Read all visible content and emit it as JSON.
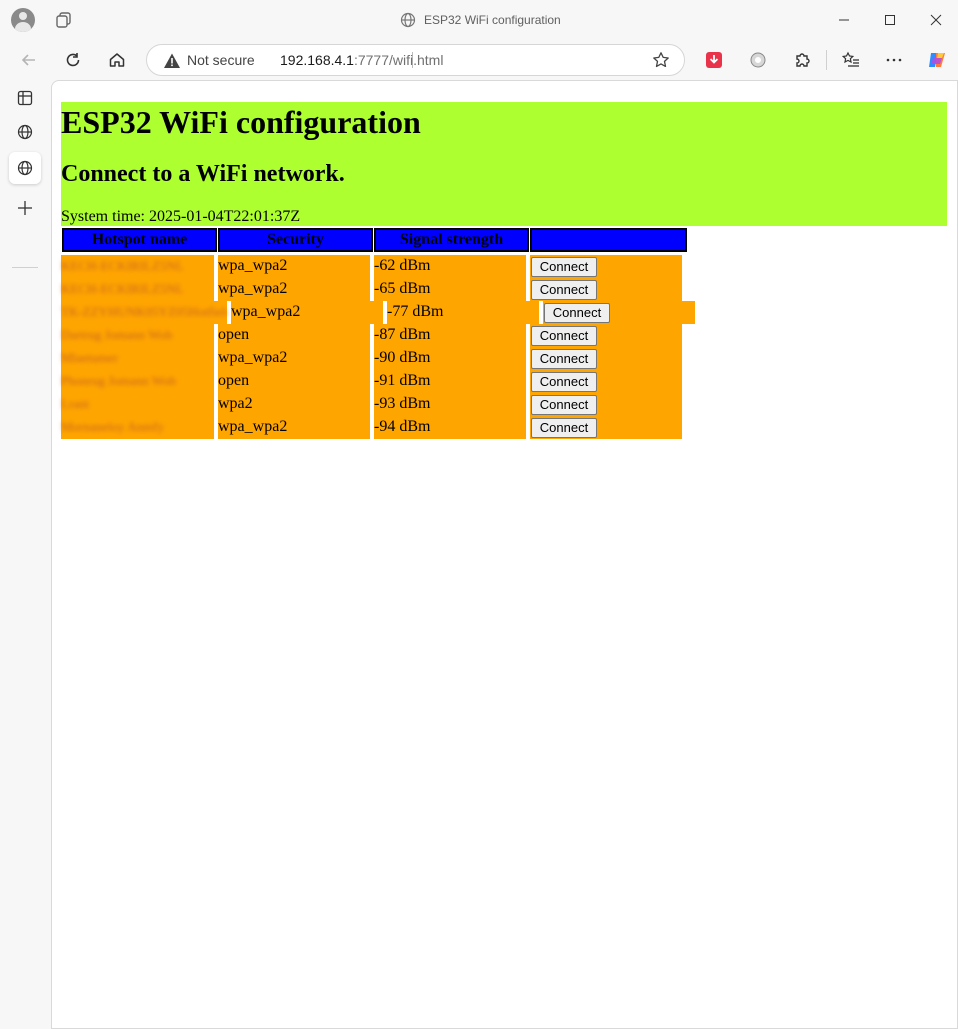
{
  "window": {
    "title": "ESP32 WiFi configuration"
  },
  "address": {
    "security": "Not secure",
    "host": "192.168.4.1",
    "rest": ":7777/wifi.html"
  },
  "page": {
    "title": "ESP32 WiFi configuration",
    "subtitle": "Connect to a WiFi network.",
    "system_time": "System time: 2025-01-04T22:01:37Z"
  },
  "table": {
    "headers": [
      "Hotspot name",
      "Security",
      "Signal strength",
      ""
    ],
    "connect_label": "Connect",
    "rows": [
      {
        "name": "KECH-ECKIRILZ5NL",
        "security": "wpa_wpa2",
        "signal": "-62 dBm"
      },
      {
        "name": "KECH-ECKIRILZ5NL",
        "security": "wpa_wpa2",
        "signal": "-65 dBm"
      },
      {
        "name": "TK-ZZYHUNK05YZ05Hotfield",
        "security": "wpa_wpa2",
        "signal": "-77 dBm"
      },
      {
        "name": "Dartrug Jomann Wob",
        "security": "open",
        "signal": "-87 dBm"
      },
      {
        "name": "Mlaetumer",
        "security": "wpa_wpa2",
        "signal": "-90 dBm"
      },
      {
        "name": "Phonrug Jomann Wob",
        "security": "open",
        "signal": "-91 dBm"
      },
      {
        "name": "Lrant",
        "security": "wpa2",
        "signal": "-93 dBm"
      },
      {
        "name": "Mornaneloy Anmfy",
        "security": "wpa_wpa2",
        "signal": "-94 dBm"
      }
    ]
  },
  "colors": {
    "header_bg": "#adff2f",
    "table_head_bg": "#0000ff",
    "row_bg": "#ffa500"
  }
}
